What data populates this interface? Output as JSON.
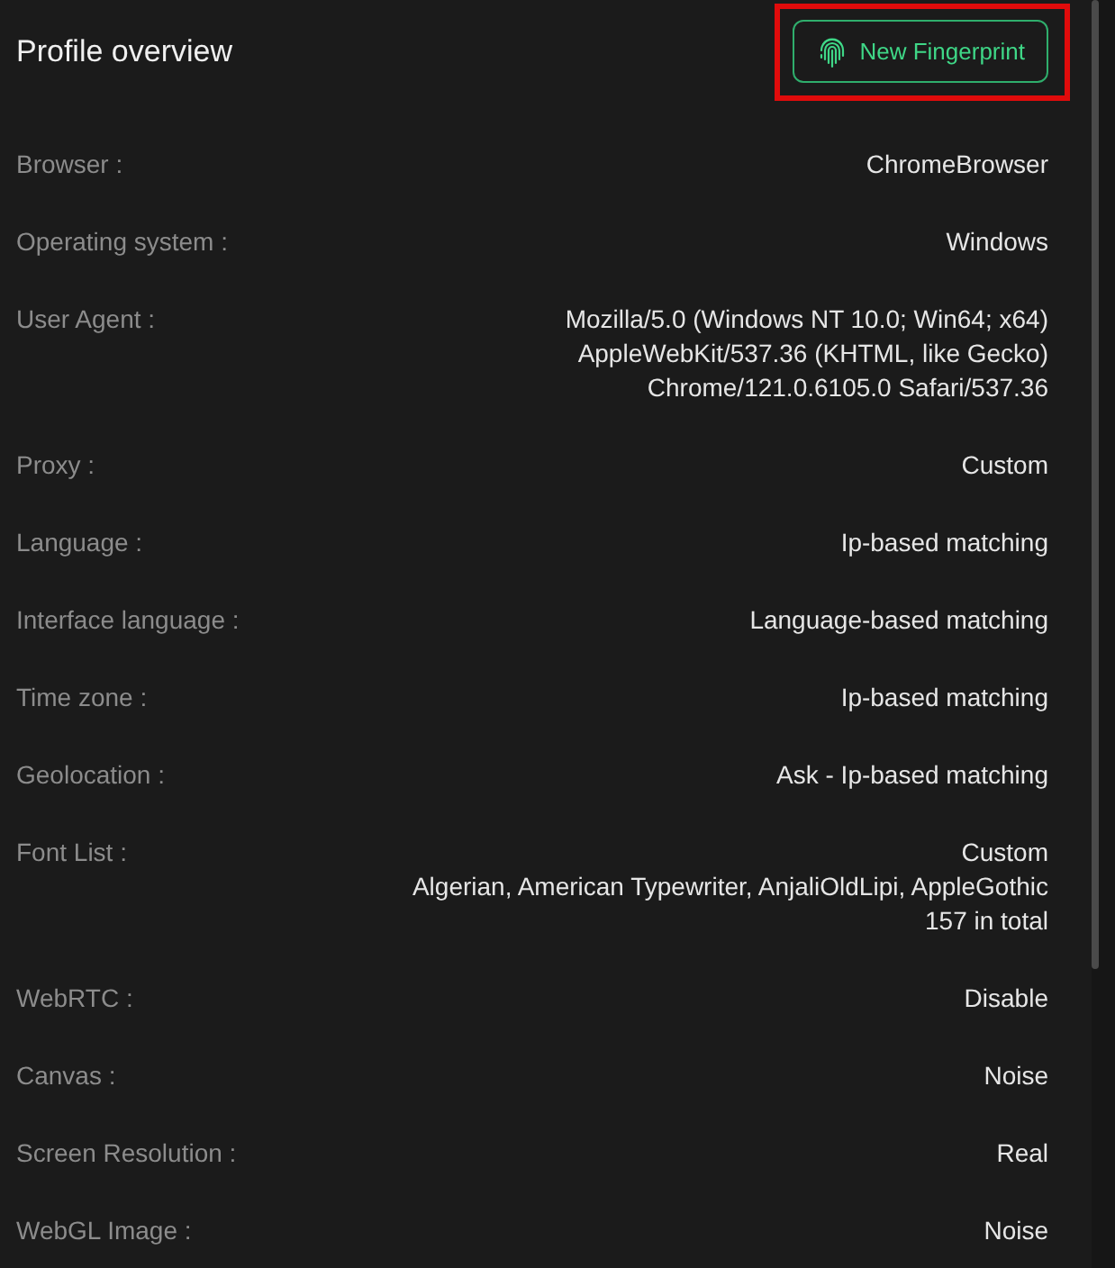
{
  "header": {
    "title": "Profile overview",
    "button": {
      "label": "New Fingerprint",
      "highlighted": true
    }
  },
  "rows": [
    {
      "label": "Browser :",
      "lines": [
        "ChromeBrowser"
      ]
    },
    {
      "label": "Operating system :",
      "lines": [
        "Windows"
      ]
    },
    {
      "label": "User Agent :",
      "lines": [
        "Mozilla/5.0 (Windows NT 10.0; Win64; x64)",
        "AppleWebKit/537.36 (KHTML, like Gecko)",
        "Chrome/121.0.6105.0 Safari/537.36"
      ]
    },
    {
      "label": "Proxy :",
      "lines": [
        "Custom"
      ]
    },
    {
      "label": "Language :",
      "lines": [
        "Ip-based matching"
      ]
    },
    {
      "label": "Interface language :",
      "lines": [
        "Language-based matching"
      ]
    },
    {
      "label": "Time zone :",
      "lines": [
        "Ip-based matching"
      ]
    },
    {
      "label": "Geolocation :",
      "lines": [
        "Ask - Ip-based matching"
      ]
    },
    {
      "label": "Font List :",
      "lines": [
        "Custom",
        "Algerian, American Typewriter, AnjaliOldLipi, AppleGothic",
        "157 in total"
      ]
    },
    {
      "label": "WebRTC :",
      "lines": [
        "Disable"
      ]
    },
    {
      "label": "Canvas :",
      "lines": [
        "Noise"
      ]
    },
    {
      "label": "Screen Resolution :",
      "lines": [
        "Real"
      ]
    },
    {
      "label": "WebGL Image :",
      "lines": [
        "Noise"
      ]
    }
  ]
}
